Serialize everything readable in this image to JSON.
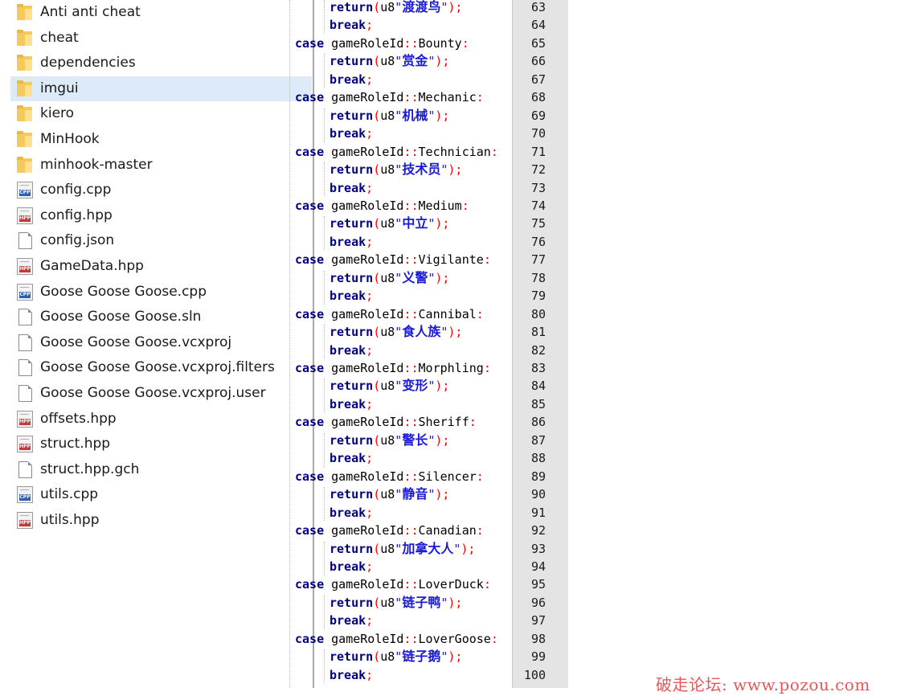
{
  "explorer": {
    "items": [
      {
        "name": "Anti anti cheat",
        "type": "folder"
      },
      {
        "name": "cheat",
        "type": "folder"
      },
      {
        "name": "dependencies",
        "type": "folder"
      },
      {
        "name": "imgui",
        "type": "folder",
        "selected": true
      },
      {
        "name": "kiero",
        "type": "folder"
      },
      {
        "name": "MinHook",
        "type": "folder"
      },
      {
        "name": "minhook-master",
        "type": "folder"
      },
      {
        "name": "config.cpp",
        "type": "cpp"
      },
      {
        "name": "config.hpp",
        "type": "hpp"
      },
      {
        "name": "config.json",
        "type": "doc"
      },
      {
        "name": "GameData.hpp",
        "type": "hpp"
      },
      {
        "name": "Goose Goose Goose.cpp",
        "type": "cpp"
      },
      {
        "name": "Goose Goose Goose.sln",
        "type": "doc"
      },
      {
        "name": "Goose Goose Goose.vcxproj",
        "type": "doc"
      },
      {
        "name": "Goose Goose Goose.vcxproj.filters",
        "type": "doc"
      },
      {
        "name": "Goose Goose Goose.vcxproj.user",
        "type": "doc"
      },
      {
        "name": "offsets.hpp",
        "type": "hpp"
      },
      {
        "name": "struct.hpp",
        "type": "hpp"
      },
      {
        "name": "struct.hpp.gch",
        "type": "doc"
      },
      {
        "name": "utils.cpp",
        "type": "cpp"
      },
      {
        "name": "utils.hpp",
        "type": "hpp"
      }
    ],
    "icon_labels": {
      "cpp": "CPP",
      "hpp": "HPP"
    }
  },
  "editor": {
    "lines": [
      {
        "n": "63",
        "kind": "return",
        "text": "渡渡鸟"
      },
      {
        "n": "64",
        "kind": "break"
      },
      {
        "n": "65",
        "kind": "case",
        "text": "Bounty"
      },
      {
        "n": "66",
        "kind": "return",
        "text": "赏金"
      },
      {
        "n": "67",
        "kind": "break"
      },
      {
        "n": "68",
        "kind": "case",
        "text": "Mechanic"
      },
      {
        "n": "69",
        "kind": "return",
        "text": "机械"
      },
      {
        "n": "70",
        "kind": "break"
      },
      {
        "n": "71",
        "kind": "case",
        "text": "Technician"
      },
      {
        "n": "72",
        "kind": "return",
        "text": "技术员"
      },
      {
        "n": "73",
        "kind": "break"
      },
      {
        "n": "74",
        "kind": "case",
        "text": "Medium"
      },
      {
        "n": "75",
        "kind": "return",
        "text": "中立"
      },
      {
        "n": "76",
        "kind": "break"
      },
      {
        "n": "77",
        "kind": "case",
        "text": "Vigilante"
      },
      {
        "n": "78",
        "kind": "return",
        "text": "义警"
      },
      {
        "n": "79",
        "kind": "break"
      },
      {
        "n": "80",
        "kind": "case",
        "text": "Cannibal"
      },
      {
        "n": "81",
        "kind": "return",
        "text": "食人族"
      },
      {
        "n": "82",
        "kind": "break"
      },
      {
        "n": "83",
        "kind": "case",
        "text": "Morphling"
      },
      {
        "n": "84",
        "kind": "return",
        "text": "变形"
      },
      {
        "n": "85",
        "kind": "break"
      },
      {
        "n": "86",
        "kind": "case",
        "text": "Sheriff"
      },
      {
        "n": "87",
        "kind": "return",
        "text": "警长"
      },
      {
        "n": "88",
        "kind": "break"
      },
      {
        "n": "89",
        "kind": "case",
        "text": "Silencer"
      },
      {
        "n": "90",
        "kind": "return",
        "text": "静音"
      },
      {
        "n": "91",
        "kind": "break"
      },
      {
        "n": "92",
        "kind": "case",
        "text": "Canadian"
      },
      {
        "n": "93",
        "kind": "return",
        "text": "加拿大人"
      },
      {
        "n": "94",
        "kind": "break"
      },
      {
        "n": "95",
        "kind": "case",
        "text": "LoverDuck"
      },
      {
        "n": "96",
        "kind": "return",
        "text": "链子鸭"
      },
      {
        "n": "97",
        "kind": "break"
      },
      {
        "n": "98",
        "kind": "case",
        "text": "LoverGoose"
      },
      {
        "n": "99",
        "kind": "return",
        "text": "链子鹅"
      },
      {
        "n": "100",
        "kind": "break"
      }
    ],
    "tokens": {
      "case_kw": "case",
      "enum_name": "gameRoleId",
      "scope": "::",
      "colon": ":",
      "return_kw": "return",
      "u8_prefix": "u8",
      "open_paren": "(",
      "close_paren": ")",
      "quote": "\"",
      "semicolon": ";",
      "break_kw": "break"
    }
  },
  "watermark": "破走论坛: www.pozou.com"
}
